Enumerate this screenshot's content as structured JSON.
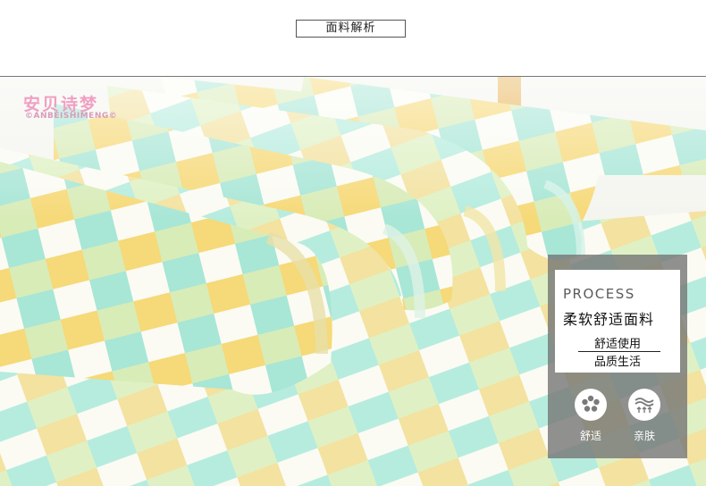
{
  "header": {
    "title": "面料解析"
  },
  "brand": {
    "name": "安贝诗梦",
    "sub": "©ANBEISHIMENG©"
  },
  "panel": {
    "kicker": "PROCESS",
    "title": "柔软舒适面料",
    "line1": "舒适使用",
    "line2": "品质生活",
    "features": [
      {
        "label": "舒适",
        "icon": "flower-icon"
      },
      {
        "label": "亲肤",
        "icon": "skin-icon"
      }
    ]
  },
  "colors": {
    "yellow": "#f6d978",
    "mint": "#a8e6d6",
    "green": "#cfe9a9",
    "white": "#fbfbf4",
    "panel": "#7a7a7a",
    "brand": "#f0a0c4"
  }
}
